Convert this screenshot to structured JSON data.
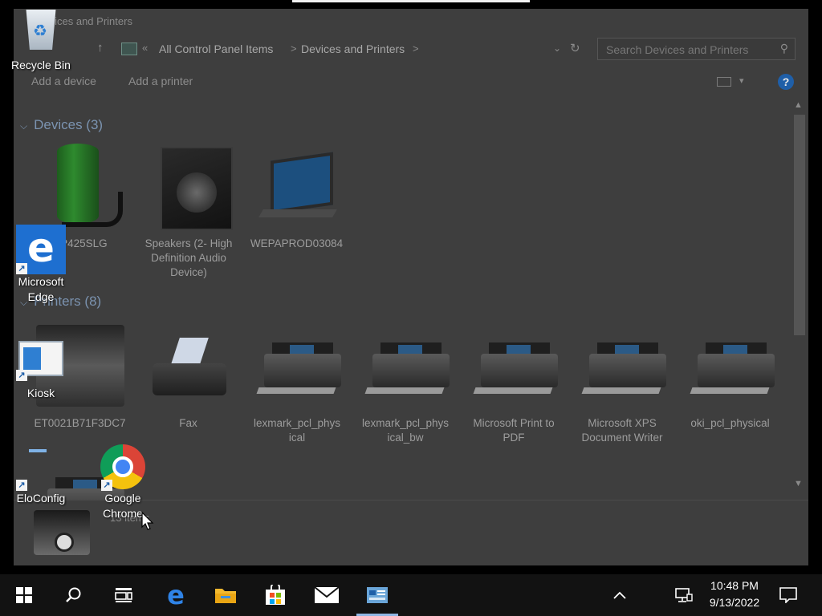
{
  "window": {
    "title": "Devices and Printers",
    "breadcrumb": [
      "All Control Panel Items",
      "Devices and Printers"
    ],
    "breadcrumb_sep": ">",
    "search_placeholder": "Search Devices and Printers",
    "commands": [
      "Add a device",
      "Add a printer"
    ],
    "help_label": "?",
    "devices_header": "Devices (3)",
    "printers_header": "Printers (8)",
    "devices": [
      {
        "label": "CP425SLG",
        "icon": "battery-icon"
      },
      {
        "label": "Speakers (2- High Definition Audio Device)",
        "icon": "speaker-icon"
      },
      {
        "label": "WEPAPROD03084",
        "icon": "laptop-icon"
      }
    ],
    "printers": [
      {
        "label": "ET0021B71F3DC7",
        "icon": "printer-icon"
      },
      {
        "label": "Fax",
        "icon": "fax-icon"
      },
      {
        "label": "lexmark_pcl_physical",
        "icon": "printer-icon"
      },
      {
        "label": "lexmark_pcl_physical_bw",
        "icon": "printer-icon"
      },
      {
        "label": "Microsoft Print to PDF",
        "icon": "printer-icon"
      },
      {
        "label": "Microsoft XPS Document Writer",
        "icon": "printer-icon"
      },
      {
        "label": "oki_pcl_physical",
        "icon": "printer-icon"
      }
    ],
    "items_count": "13 items"
  },
  "desktop": {
    "icons": [
      {
        "label": "Recycle Bin",
        "icon": "recycle-bin-icon"
      },
      {
        "label": "Microsoft Edge",
        "icon": "edge-icon"
      },
      {
        "label": "Kiosk",
        "icon": "kiosk-icon"
      },
      {
        "label": "EloConfig",
        "icon": "eloconfig-icon"
      },
      {
        "label": "Google Chrome",
        "icon": "chrome-icon"
      }
    ]
  },
  "taskbar": {
    "time": "10:48 PM",
    "date": "9/13/2022",
    "accent": "#8fb6e4"
  }
}
